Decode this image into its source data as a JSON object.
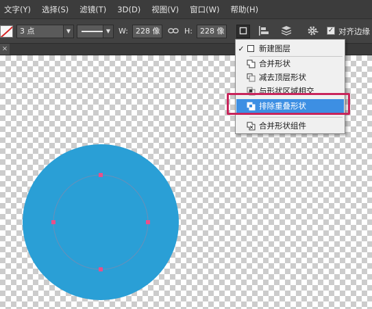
{
  "menubar": {
    "items": [
      "文字(Y)",
      "选择(S)",
      "滤镜(T)",
      "3D(D)",
      "视图(V)",
      "窗口(W)",
      "帮助(H)"
    ]
  },
  "options_bar": {
    "stroke_size": "3 点",
    "width_label": "W:",
    "width_value": "228 像",
    "height_label": "H:",
    "height_value": "228 像",
    "align_edges_label": "对齐边缘",
    "align_edges_checked": true
  },
  "tabstrip": {
    "close_glyph": "×"
  },
  "path_operations_menu": {
    "items": [
      {
        "label": "新建图层",
        "checked": true,
        "icon": "new-layer-icon"
      },
      {
        "label": "合并形状",
        "checked": false,
        "icon": "combine-shapes-icon"
      },
      {
        "label": "减去顶层形状",
        "checked": false,
        "icon": "subtract-front-shape-icon"
      },
      {
        "label": "与形状区域相交",
        "checked": false,
        "icon": "intersect-shapes-icon"
      },
      {
        "label": "排除重叠形状",
        "checked": false,
        "highlighted": true,
        "icon": "exclude-overlapping-shapes-icon"
      },
      {
        "label": "合并形状组件",
        "checked": false,
        "icon": "merge-shape-components-icon"
      }
    ]
  },
  "canvas": {
    "shape_fill_color": "#2a9fd6",
    "anchor_color": "#e8508a",
    "highlight_color": "#c8235a",
    "menu_highlight_color": "#3d8fe3"
  }
}
